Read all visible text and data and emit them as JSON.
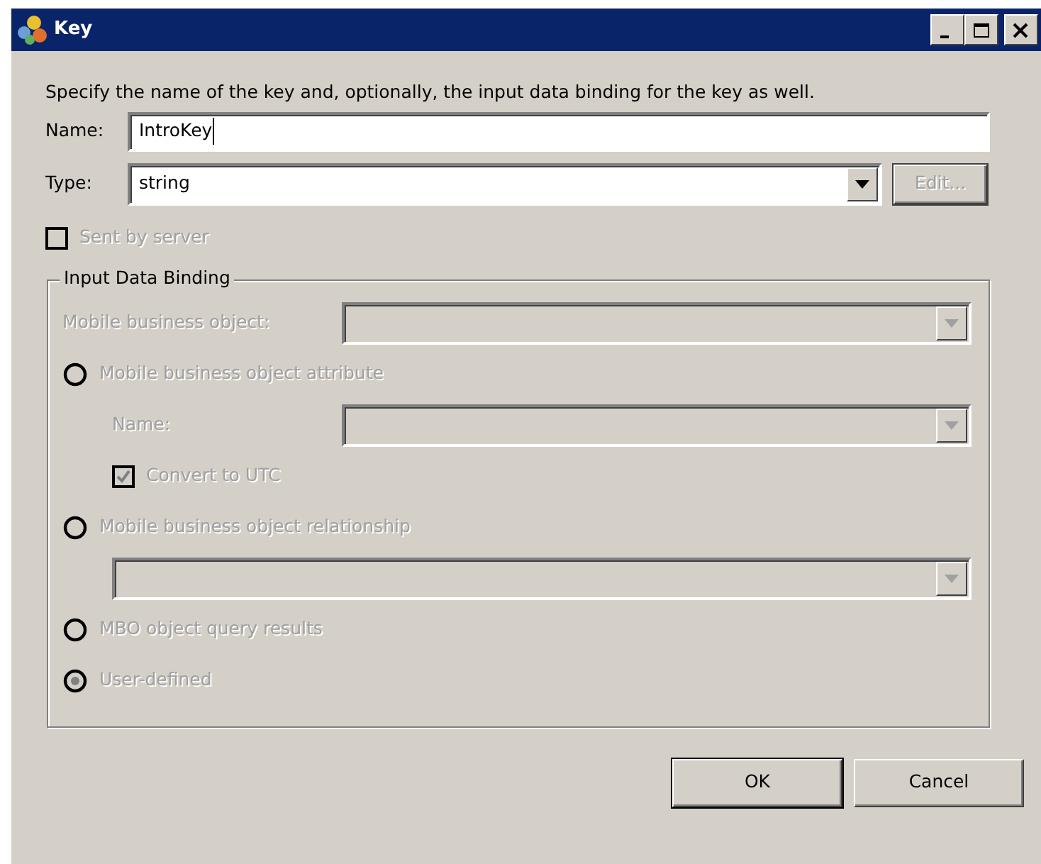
{
  "window": {
    "title": "Key"
  },
  "description": "Specify the name of the key and, optionally, the input data binding for the key as well.",
  "name_field": {
    "label": "Name:",
    "value": "IntroKey"
  },
  "type_field": {
    "label": "Type:",
    "value": "string"
  },
  "edit_button": {
    "label": "Edit...",
    "disabled": true
  },
  "sent_by_server": {
    "label": "Sent by server",
    "checked": false,
    "disabled": true
  },
  "binding": {
    "title": "Input Data Binding",
    "disabled": true,
    "mbo_label": "Mobile business object:",
    "options": [
      {
        "label": "Mobile business object attribute",
        "selected": false,
        "children": [
          {
            "kind": "combo",
            "label": "Name:"
          },
          {
            "kind": "checkbox",
            "label": "Convert to UTC",
            "checked": true
          }
        ]
      },
      {
        "label": "Mobile business object relationship",
        "selected": false,
        "children": [
          {
            "kind": "combo"
          }
        ]
      },
      {
        "label": "MBO object query results",
        "selected": false
      },
      {
        "label": "User-defined",
        "selected": true
      }
    ]
  },
  "buttons": [
    {
      "label": "OK",
      "default": true
    },
    {
      "label": "Cancel",
      "default": false
    }
  ]
}
